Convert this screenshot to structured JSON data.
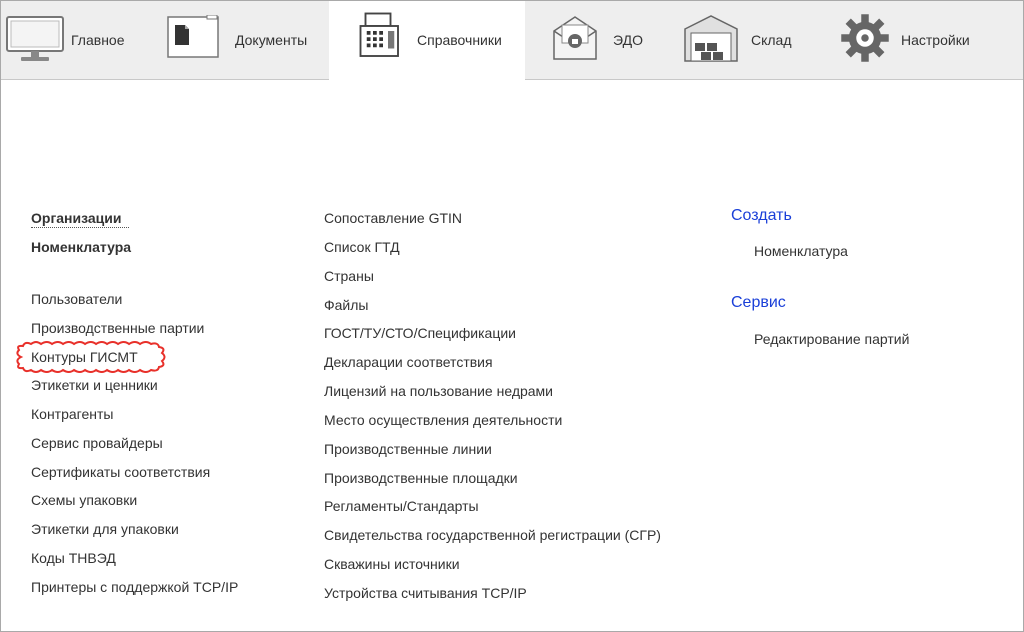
{
  "nav": [
    {
      "label": "Главное",
      "icon": "monitor-icon"
    },
    {
      "label": "Документы",
      "icon": "document-icon"
    },
    {
      "label": "Справочники",
      "icon": "directory-icon",
      "active": true
    },
    {
      "label": "ЭДО",
      "icon": "edo-envelope-icon"
    },
    {
      "label": "Склад",
      "icon": "warehouse-icon"
    },
    {
      "label": "Настройки",
      "icon": "gear-icon"
    }
  ],
  "col1": {
    "primary": [
      "Организации",
      "Номенклатура"
    ],
    "items": [
      "Пользователи",
      "Производственные партии",
      "Контуры ГИСМТ",
      "Этикетки и ценники",
      "Контрагенты",
      "Сервис провайдеры",
      "Сертификаты соответствия",
      "Схемы упаковки",
      "Этикетки для упаковки",
      "Коды ТНВЭД",
      "Принтеры с поддержкой TCP/IP"
    ]
  },
  "col2": {
    "items": [
      "Сопоставление GTIN",
      "Список ГТД",
      "Страны",
      "Файлы",
      "ГОСТ/ТУ/СТО/Спецификации",
      "Декларации соответствия",
      "Лицензий на пользование недрами",
      "Место осуществления деятельности",
      "Производственные линии",
      "Производственные площадки",
      "Регламенты/Стандарты",
      "Свидетельства государственной регистрации (СГР)",
      "Скважины источники",
      "Устройства считывания TCP/IP"
    ]
  },
  "col3": {
    "create_title": "Создать",
    "create_items": [
      "Номенклатура"
    ],
    "service_title": "Сервис",
    "service_items": [
      "Редактирование партий"
    ]
  },
  "colors": {
    "accent_link": "#1a3fd8",
    "highlight": "#e8302a",
    "topbar": "#eeeeee"
  }
}
